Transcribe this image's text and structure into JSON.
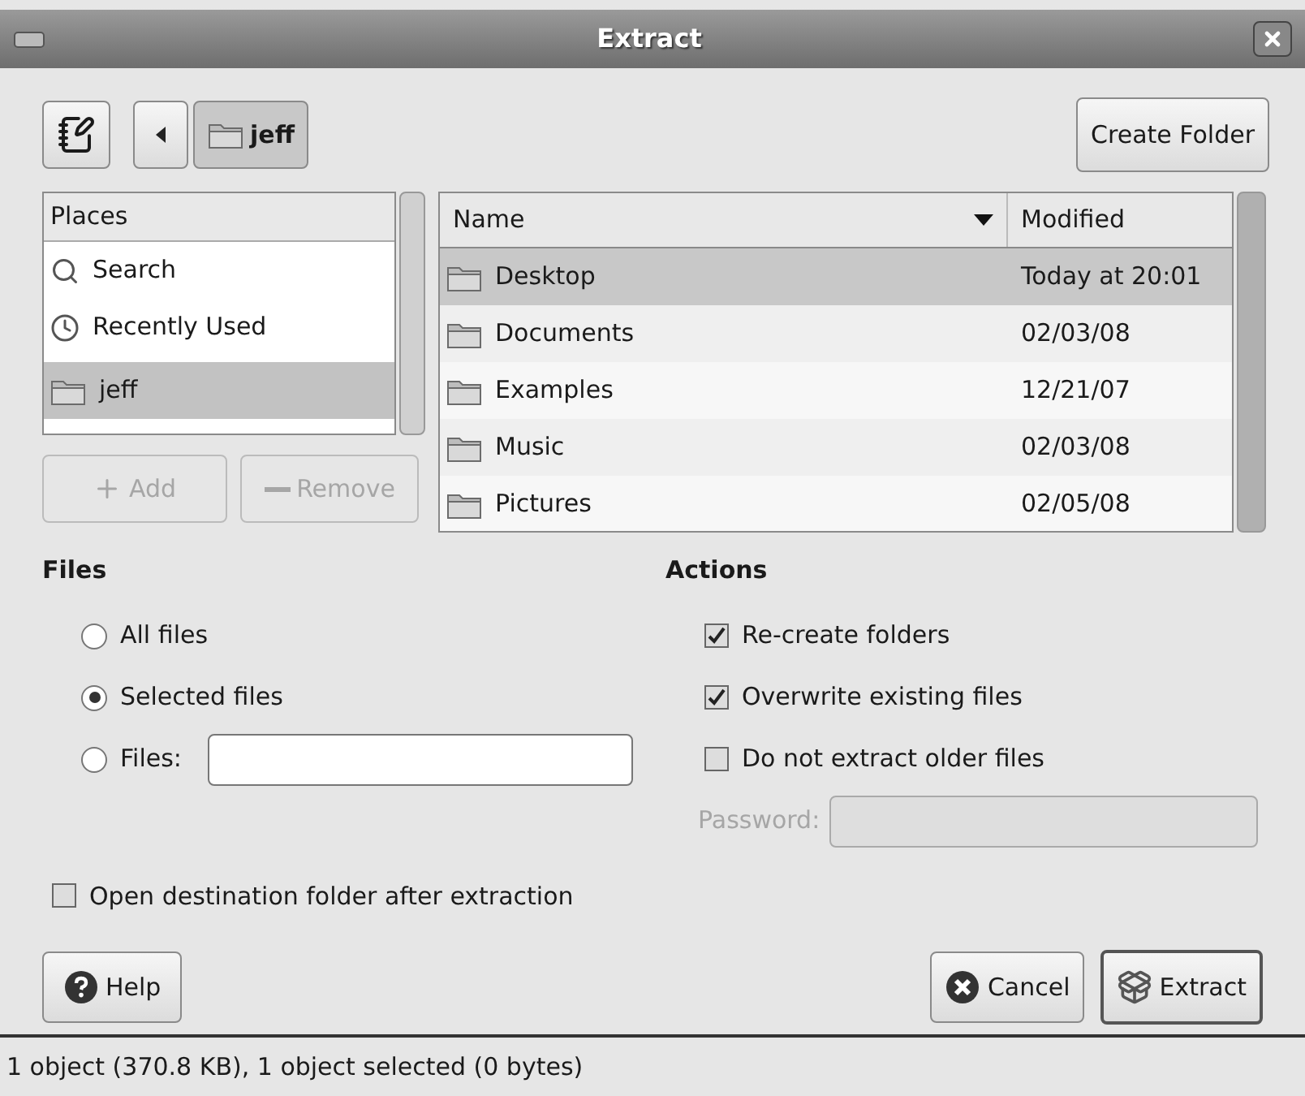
{
  "window": {
    "title": "Extract"
  },
  "toolbar": {
    "path_button": "jeff",
    "create_folder": "Create Folder"
  },
  "places": {
    "header": "Places",
    "items": [
      {
        "label": "Search",
        "kind": "search",
        "selected": false
      },
      {
        "label": "Recently Used",
        "kind": "recent",
        "selected": false
      },
      {
        "label": "jeff",
        "kind": "folder",
        "selected": true
      }
    ],
    "add": {
      "label": "Add",
      "disabled": true
    },
    "remove": {
      "label": "Remove",
      "disabled": true
    }
  },
  "file_list": {
    "columns": [
      "Name",
      "Modified"
    ],
    "rows": [
      {
        "name": "Desktop",
        "modified": "Today at 20:01",
        "selected": true
      },
      {
        "name": "Documents",
        "modified": "02/03/08",
        "selected": false
      },
      {
        "name": "Examples",
        "modified": "12/21/07",
        "selected": false
      },
      {
        "name": "Music",
        "modified": "02/03/08",
        "selected": false
      },
      {
        "name": "Pictures",
        "modified": "02/05/08",
        "selected": false
      }
    ]
  },
  "files": {
    "title": "Files",
    "options": [
      {
        "label": "All files",
        "kind": "plain",
        "selected": false
      },
      {
        "label": "Selected files",
        "kind": "plain",
        "selected": true
      },
      {
        "label": "Files:",
        "kind": "field",
        "selected": false
      }
    ]
  },
  "actions": {
    "title": "Actions",
    "options": [
      {
        "label": "Re-create folders",
        "checked": true
      },
      {
        "label": "Overwrite existing files",
        "checked": true
      },
      {
        "label": "Do not extract older files",
        "checked": false
      }
    ],
    "password": {
      "label": "Password:",
      "disabled": true
    }
  },
  "open_destination": {
    "label": "Open destination folder after extraction",
    "checked": false
  },
  "buttons": {
    "help": "Help",
    "cancel": "Cancel",
    "extract": "Extract"
  },
  "status_bar": "1 object (370.8 KB), 1 object selected (0 bytes)"
}
